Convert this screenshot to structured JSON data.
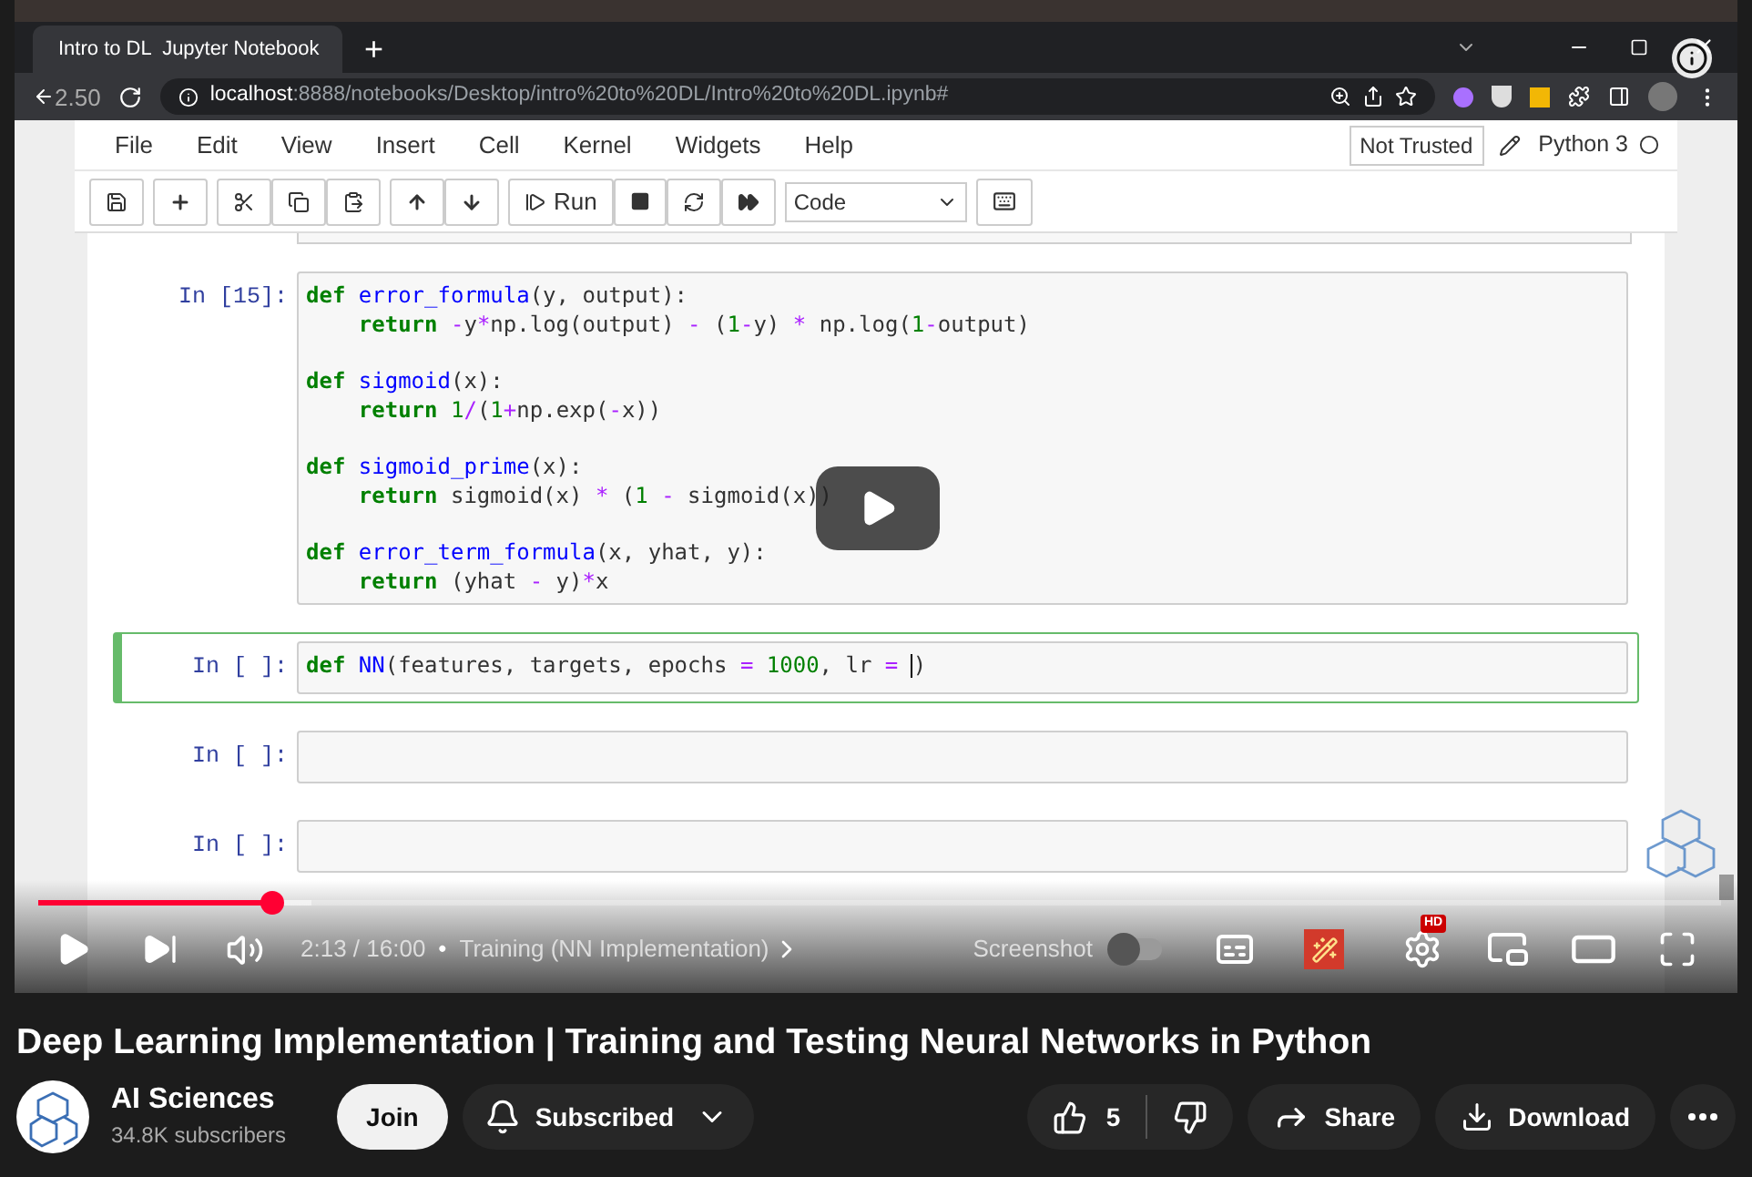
{
  "browser": {
    "tab_title": "Intro to DL  Jupyter Notebook",
    "new_tab": "+",
    "overlay_text": "2.50",
    "url_host": "localhost",
    "url_rest": ":8888/notebooks/Desktop/intro%20to%20DL/Intro%20to%20DL.ipynb#"
  },
  "jupyter": {
    "menu": [
      "File",
      "Edit",
      "View",
      "Insert",
      "Cell",
      "Kernel",
      "Widgets",
      "Help"
    ],
    "trusted": "Not Trusted",
    "kernel": "Python 3",
    "run_label": "Run",
    "cell_type": "Code"
  },
  "cells": [
    {
      "prompt": "In [15]:",
      "selected": false,
      "blocks": [
        [
          [
            {
              "text": "def ",
              "kind": "kw"
            },
            {
              "text": "error_formula",
              "kind": "fn"
            },
            {
              "text": "(y, output):",
              "kind": "plain"
            }
          ],
          [
            {
              "text": "    return",
              "kind": "kw"
            },
            {
              "text": " -",
              "kind": "op"
            },
            {
              "text": "y",
              "kind": "plain"
            },
            {
              "text": "*",
              "kind": "op"
            },
            {
              "text": "np.log(output) ",
              "kind": "plain"
            },
            {
              "text": "-",
              "kind": "op"
            },
            {
              "text": " (",
              "kind": "plain"
            },
            {
              "text": "1",
              "kind": "num"
            },
            {
              "text": "-",
              "kind": "op"
            },
            {
              "text": "y) ",
              "kind": "plain"
            },
            {
              "text": "*",
              "kind": "op"
            },
            {
              "text": " np.log(",
              "kind": "plain"
            },
            {
              "text": "1",
              "kind": "num"
            },
            {
              "text": "-",
              "kind": "op"
            },
            {
              "text": "output)",
              "kind": "plain"
            }
          ]
        ],
        [
          [
            {
              "text": "def ",
              "kind": "kw"
            },
            {
              "text": "sigmoid",
              "kind": "fn"
            },
            {
              "text": "(x):",
              "kind": "plain"
            }
          ],
          [
            {
              "text": "    return",
              "kind": "kw"
            },
            {
              "text": " 1",
              "kind": "num"
            },
            {
              "text": "/",
              "kind": "op"
            },
            {
              "text": "(",
              "kind": "plain"
            },
            {
              "text": "1",
              "kind": "num"
            },
            {
              "text": "+",
              "kind": "op"
            },
            {
              "text": "np.exp(",
              "kind": "plain"
            },
            {
              "text": "-",
              "kind": "op"
            },
            {
              "text": "x))",
              "kind": "plain"
            }
          ]
        ],
        [
          [
            {
              "text": "def ",
              "kind": "kw"
            },
            {
              "text": "sigmoid_prime",
              "kind": "fn"
            },
            {
              "text": "(x):",
              "kind": "plain"
            }
          ],
          [
            {
              "text": "    return",
              "kind": "kw"
            },
            {
              "text": " sigmoid(x) ",
              "kind": "plain"
            },
            {
              "text": "*",
              "kind": "op"
            },
            {
              "text": " (",
              "kind": "plain"
            },
            {
              "text": "1",
              "kind": "num"
            },
            {
              "text": " -",
              "kind": "op"
            },
            {
              "text": " sigmoid(x))",
              "kind": "plain"
            }
          ]
        ],
        [
          [
            {
              "text": "def ",
              "kind": "kw"
            },
            {
              "text": "error_term_formula",
              "kind": "fn"
            },
            {
              "text": "(x, yhat, y):",
              "kind": "plain"
            }
          ],
          [
            {
              "text": "    return",
              "kind": "kw"
            },
            {
              "text": " (yhat ",
              "kind": "plain"
            },
            {
              "text": "-",
              "kind": "op"
            },
            {
              "text": " y)",
              "kind": "plain"
            },
            {
              "text": "*",
              "kind": "op"
            },
            {
              "text": "x",
              "kind": "plain"
            }
          ]
        ]
      ]
    },
    {
      "prompt": "In [ ]:",
      "selected": true,
      "blocks": [
        [
          [
            {
              "text": "def ",
              "kind": "kw"
            },
            {
              "text": "NN",
              "kind": "fn"
            },
            {
              "text": "(features, targets, epochs ",
              "kind": "plain"
            },
            {
              "text": "=",
              "kind": "op"
            },
            {
              "text": " 1000",
              "kind": "num"
            },
            {
              "text": ", lr ",
              "kind": "plain"
            },
            {
              "text": "= ",
              "kind": "op"
            },
            {
              "kind": "cursor"
            },
            {
              "text": ")",
              "kind": "plain"
            }
          ]
        ]
      ]
    },
    {
      "prompt": "In [ ]:",
      "selected": false
    },
    {
      "prompt": "In [ ]:",
      "selected": false
    }
  ],
  "player": {
    "level": 0.139,
    "time": "2:13 / 16:00",
    "separator": "•",
    "chapter": "Training (NN Implementation)",
    "screenshot_label": "Screenshot",
    "screenshot_on": false,
    "hd_badge": "HD"
  },
  "video": {
    "title": "Deep Learning Implementation | Training and Testing Neural Networks in Python",
    "channel": "AI Sciences",
    "subscribers": "34.8K subscribers",
    "join": "Join",
    "subscribed": "Subscribed",
    "likes": "5",
    "share": "Share",
    "download": "Download"
  }
}
